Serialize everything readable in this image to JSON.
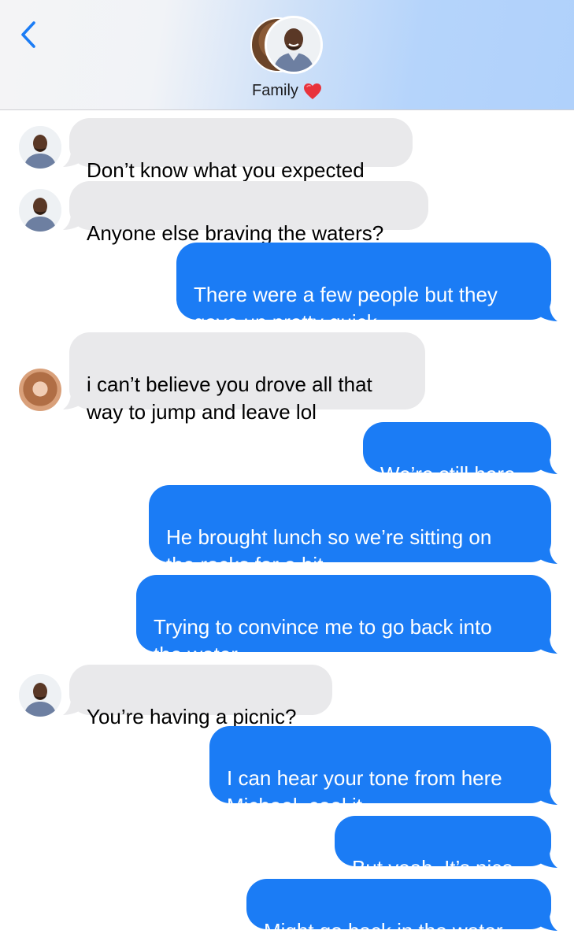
{
  "header": {
    "back_icon": "chevron-left-icon",
    "title": "Family",
    "title_emoji": "red-heart-icon",
    "accent": "#1b7cf5"
  },
  "colors": {
    "incoming_bubble": "#e9e9eb",
    "outgoing_bubble": "#1b7cf5"
  },
  "messages": [
    {
      "direction": "incoming",
      "sender": "man",
      "text": "Don’t know what you expected"
    },
    {
      "direction": "incoming",
      "sender": "man",
      "text": "Anyone else braving the waters?"
    },
    {
      "direction": "outgoing",
      "text": "There were a few people but they\ngave up pretty quick."
    },
    {
      "direction": "incoming",
      "sender": "woman",
      "text": "i can’t believe you drove all that\nway to jump and leave lol"
    },
    {
      "direction": "outgoing",
      "text": "We’re still here."
    },
    {
      "direction": "outgoing",
      "text": "He brought lunch so we’re sitting on\nthe rocks for a bit."
    },
    {
      "direction": "outgoing",
      "text": "Trying to convince me to go back into\nthe water."
    },
    {
      "direction": "incoming",
      "sender": "man",
      "text": "You’re having a picnic?"
    },
    {
      "direction": "outgoing",
      "text": "I can hear your tone from here\nMichael, cool it."
    },
    {
      "direction": "outgoing",
      "text": "But yeah. It’s nice."
    },
    {
      "direction": "outgoing",
      "text": "Might go back in the water."
    }
  ]
}
